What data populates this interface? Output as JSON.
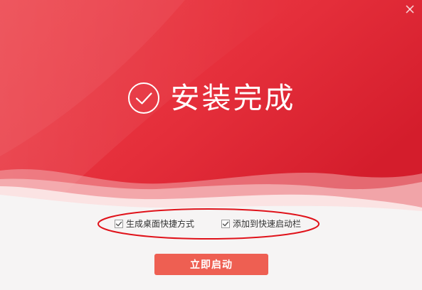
{
  "window": {
    "close_icon": "close-icon"
  },
  "status": {
    "title": "安装完成",
    "icon": "checkmark-circle-icon"
  },
  "options": [
    {
      "label": "生成桌面快捷方式",
      "checked": true
    },
    {
      "label": "添加到快速启动栏",
      "checked": true
    }
  ],
  "actions": {
    "launch_label": "立即启动"
  },
  "colors": {
    "banner_red": "#e8333d",
    "banner_dark_red": "#d61f2e",
    "background": "#f6f4f4",
    "button": "#ee5f52",
    "highlight_ring": "#e0121a"
  }
}
